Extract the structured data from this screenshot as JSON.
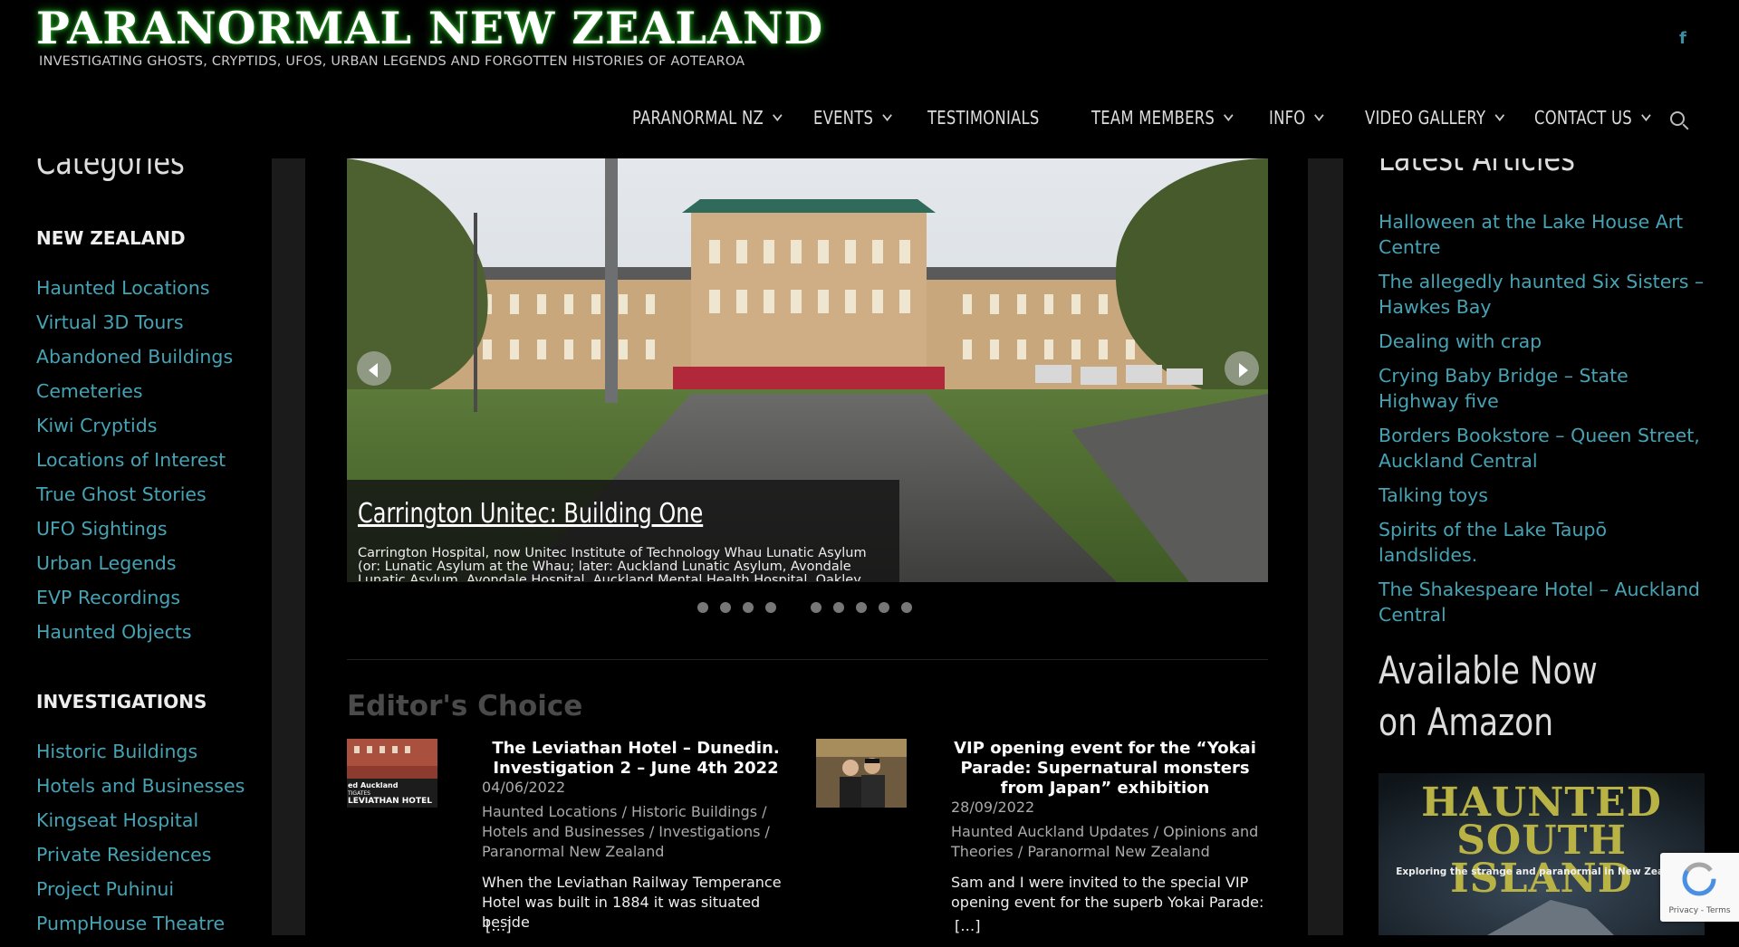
{
  "site": {
    "title": "PARANORMAL NEW ZEALAND",
    "tagline": "INVESTIGATING GHOSTS, CRYPTIDS, UFOS, URBAN LEGENDS AND FORGOTTEN HISTORIES OF AOTEAROA"
  },
  "nav": {
    "items": [
      {
        "label": "PARANORMAL NZ",
        "dropdown": true
      },
      {
        "label": "EVENTS",
        "dropdown": true
      },
      {
        "label": "TESTIMONIALS",
        "dropdown": false
      },
      {
        "label": "TEAM MEMBERS",
        "dropdown": true
      },
      {
        "label": "INFO",
        "dropdown": true
      },
      {
        "label": "VIDEO GALLERY",
        "dropdown": true
      },
      {
        "label": "CONTACT US",
        "dropdown": true
      }
    ],
    "social_icon": "facebook-icon",
    "facebook_glyph": "f",
    "search_icon": "search-icon"
  },
  "left_sidebar": {
    "title": "Categories",
    "sections": [
      {
        "heading": "NEW ZEALAND",
        "items": [
          "Haunted Locations",
          "Virtual 3D Tours",
          "Abandoned Buildings",
          "Cemeteries",
          "Kiwi Cryptids",
          "Locations of Interest",
          "True Ghost Stories",
          "UFO Sightings",
          "Urban Legends",
          "EVP Recordings",
          "Haunted Objects"
        ]
      },
      {
        "heading": "INVESTIGATIONS",
        "items": [
          "Historic Buildings",
          "Hotels and Businesses",
          "Kingseat Hospital",
          "Private Residences",
          "Project Puhinui",
          "PumpHouse Theatre"
        ]
      }
    ]
  },
  "slider": {
    "title": "Carrington Unitec: Building One",
    "excerpt": "Carrington Hospital, now Unitec Institute of Technology Whau Lunatic Asylum (or: Lunatic Asylum at the Whau; later: Auckland Lunatic Asylum, Avondale Lunatic Asylum, Avondale Hospital, Auckland Mental Health Hospital, Oakley Hospital; Carrington",
    "slide_count": 9,
    "active_slide": 1
  },
  "editors_choice": {
    "title": "Editor's Choice",
    "posts": [
      {
        "title": "The Leviathan Hotel – Dunedin. Investigation 2 – June 4th 2022",
        "date": "04/06/2022",
        "categories": "Haunted Locations / Historic Buildings / Hotels and Businesses / Investigations / Paranormal New Zealand",
        "excerpt": "When the Leviathan Railway Temperance Hotel was built in 1884 it was situated beside",
        "more": "[…]",
        "thumb_text1": "ed Auckland",
        "thumb_text2": "TIGATES",
        "thumb_text3": "LEVIATHAN HOTEL"
      },
      {
        "title": "VIP opening event for the “Yokai Parade: Supernatural monsters from Japan” exhibition",
        "date": "28/09/2022",
        "categories": "Haunted Auckland Updates / Opinions and Theories / Paranormal New Zealand",
        "excerpt": "Sam and I were invited to the special VIP opening event for the superb Yokai Parade:",
        "more": "[…]"
      }
    ]
  },
  "right_sidebar": {
    "latest_title": "Latest Articles",
    "latest": [
      "Halloween at the Lake House Art Centre",
      "The allegedly haunted Six Sisters – Hawkes Bay",
      "Dealing with crap",
      "Crying Baby Bridge – State Highway five",
      "Borders Bookstore – Queen Street, Auckland Central",
      "Talking toys",
      "Spirits of the Lake Taupō landslides.",
      "The Shakespeare Hotel – Auckland Central"
    ],
    "amazon_title": "Available Now on Amazon",
    "book": {
      "title_line1": "HAUNTED",
      "title_line2": "SOUTH ISLAND",
      "subtitle": "Exploring the strange and paranormal in New Zealand"
    }
  },
  "recaptcha": {
    "label": "Privacy - Terms"
  },
  "colors": {
    "link": "#46a3b4",
    "background": "#000000",
    "gutter": "#1b1b1b",
    "title_glow": "#1f9a1f"
  }
}
